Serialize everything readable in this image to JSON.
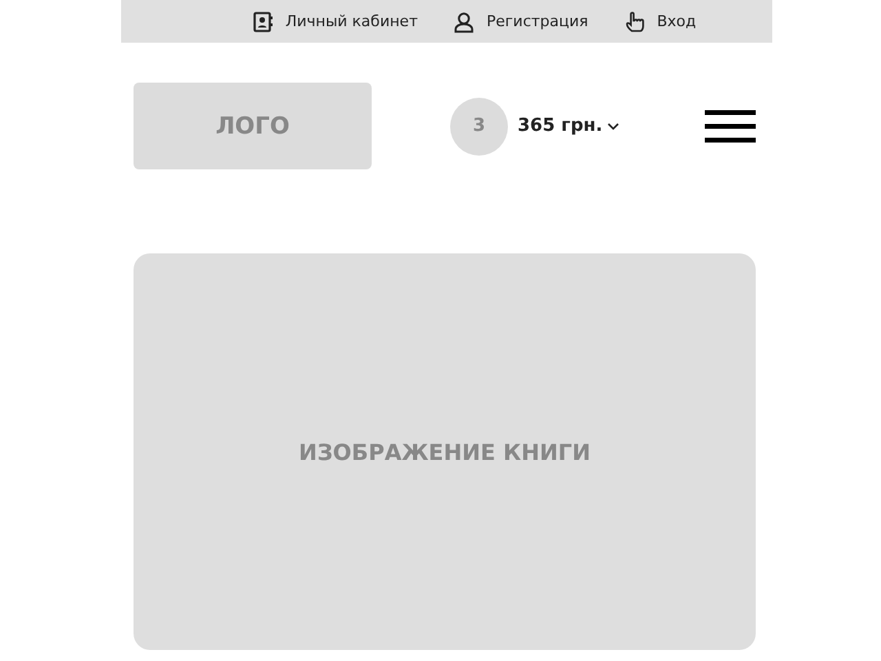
{
  "top_links": [
    {
      "kind": "cabinet",
      "label": "Личный кабинет"
    },
    {
      "kind": "register",
      "label": "Регистрация"
    },
    {
      "kind": "login",
      "label": "Вход"
    }
  ],
  "header": {
    "logo": "ЛОГО",
    "cart_count": "3",
    "cart_total": "365 грн."
  },
  "book_image": {
    "label": "ИЗОБРАЖЕНИЕ КНИГИ"
  }
}
